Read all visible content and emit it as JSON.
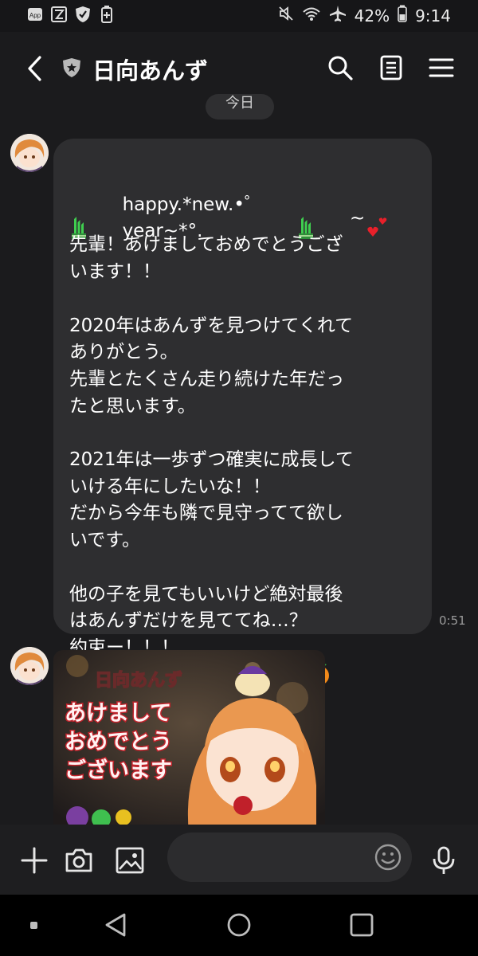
{
  "status_bar": {
    "battery": "42%",
    "time": "9:14",
    "left_icons": [
      "app-icon",
      "kindle-like-icon",
      "shield-check-icon",
      "battery-saver-icon"
    ],
    "right_icons": [
      "mute-icon",
      "wifi-icon",
      "airplane-icon"
    ]
  },
  "header": {
    "title": "日向あんず",
    "icons": [
      "back-icon",
      "official-shield-icon",
      "search-icon",
      "notes-icon",
      "menu-icon"
    ]
  },
  "date_separator": "今日",
  "messages": [
    {
      "type": "text",
      "first_line": "happy.*new.•゜year~*°.",
      "first_line_suffix": "~",
      "body": "先輩！あけましておめでとうござ\nいます！！\n\n2020年はあんずを見つけてくれて\nありがとう。\n先輩とたくさん走り続けた年だっ\nたと思います。\n\n2021年は一歩ずつ確実に成長して\nいける年にしたいな！！\nだから今年も隣で見守ってて欲し\nいです。\n\n他の子を見てもいいけど絶対最後\nはあんずだけを見ててね…？\n約束ー！！！\n今年もよろしくお願いします",
      "time": "0:51",
      "emoji": [
        "kadomatsu-icon",
        "kadomatsu-icon",
        "hearts-icon",
        "tangerine-icon"
      ]
    },
    {
      "type": "image",
      "image_text": {
        "name": "日向あんず",
        "greeting_lines": [
          "あけまして",
          "おめでとう",
          "ございます"
        ]
      }
    }
  ],
  "input_bar": {
    "placeholder": "",
    "icons": [
      "plus-icon",
      "camera-icon",
      "gallery-icon",
      "emoji-icon",
      "mic-icon"
    ]
  },
  "nav_bar": {
    "icons": [
      "recents-dot-icon",
      "back-triangle-icon",
      "home-circle-icon",
      "overview-square-icon"
    ]
  },
  "colors": {
    "background": "#1b1b1d",
    "bubble": "#2e2e30",
    "text": "#ffffff",
    "muted": "#9a9a9a"
  }
}
